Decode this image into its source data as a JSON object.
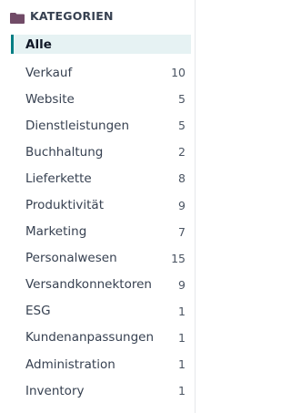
{
  "header": {
    "title": "KATEGORIEN",
    "icon": "folder-icon",
    "icon_color": "#714b67"
  },
  "categories": [
    {
      "label": "Alle",
      "count": "",
      "active": true
    },
    {
      "label": "Verkauf",
      "count": "10"
    },
    {
      "label": "Website",
      "count": "5"
    },
    {
      "label": "Dienstleistungen",
      "count": "5"
    },
    {
      "label": "Buchhaltung",
      "count": "2"
    },
    {
      "label": "Lieferkette",
      "count": "8"
    },
    {
      "label": "Produktivität",
      "count": "9"
    },
    {
      "label": "Marketing",
      "count": "7"
    },
    {
      "label": "Personalwesen",
      "count": "15"
    },
    {
      "label": "Versandkonnektoren",
      "count": "9"
    },
    {
      "label": "ESG",
      "count": "1"
    },
    {
      "label": "Kundenanpassungen",
      "count": "1"
    },
    {
      "label": "Administration",
      "count": "1"
    },
    {
      "label": "Inventory",
      "count": "1"
    }
  ],
  "colors": {
    "accent": "#017e84",
    "active_background": "#e6f2f3"
  }
}
